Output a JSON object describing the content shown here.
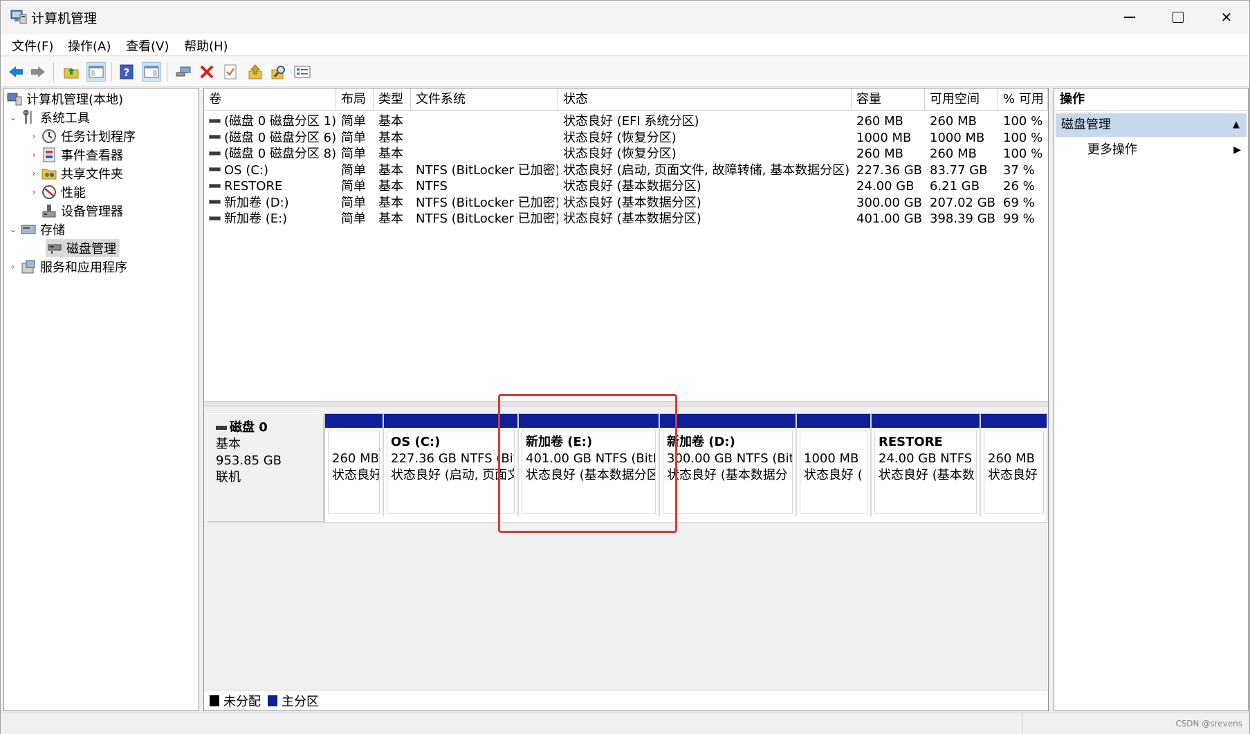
{
  "window": {
    "title": "计算机管理"
  },
  "menu": [
    "文件(F)",
    "操作(A)",
    "查看(V)",
    "帮助(H)"
  ],
  "toolbar": [
    "back-icon",
    "forward-icon",
    "up-folder-icon",
    "show-hide-tree-icon",
    "help-icon",
    "show-hide-action-pane-icon",
    "connect-icon",
    "delete-icon",
    "properties-icon",
    "export-icon",
    "search-icon",
    "view-icon"
  ],
  "tree": {
    "root": "计算机管理(本地)",
    "system_tools": "系统工具",
    "task_scheduler": "任务计划程序",
    "event_viewer": "事件查看器",
    "shared_folders": "共享文件夹",
    "performance": "性能",
    "device_manager": "设备管理器",
    "storage": "存储",
    "disk_management": "磁盘管理",
    "services_apps": "服务和应用程序"
  },
  "table": {
    "columns": [
      "卷",
      "布局",
      "类型",
      "文件系统",
      "状态",
      "容量",
      "可用空间",
      "% 可用"
    ],
    "rows": [
      [
        "(磁盘 0 磁盘分区 1)",
        "简单",
        "基本",
        "",
        "状态良好 (EFI 系统分区)",
        "260 MB",
        "260 MB",
        "100 %"
      ],
      [
        "(磁盘 0 磁盘分区 6)",
        "简单",
        "基本",
        "",
        "状态良好 (恢复分区)",
        "1000 MB",
        "1000 MB",
        "100 %"
      ],
      [
        "(磁盘 0 磁盘分区 8)",
        "简单",
        "基本",
        "",
        "状态良好 (恢复分区)",
        "260 MB",
        "260 MB",
        "100 %"
      ],
      [
        "OS (C:)",
        "简单",
        "基本",
        "NTFS (BitLocker 已加密)",
        "状态良好 (启动, 页面文件, 故障转储, 基本数据分区)",
        "227.36 GB",
        "83.77 GB",
        "37 %"
      ],
      [
        "RESTORE",
        "简单",
        "基本",
        "NTFS",
        "状态良好 (基本数据分区)",
        "24.00 GB",
        "6.21 GB",
        "26 %"
      ],
      [
        "新加卷 (D:)",
        "简单",
        "基本",
        "NTFS (BitLocker 已加密)",
        "状态良好 (基本数据分区)",
        "300.00 GB",
        "207.02 GB",
        "69 %"
      ],
      [
        "新加卷 (E:)",
        "简单",
        "基本",
        "NTFS (BitLocker 已加密)",
        "状态良好 (基本数据分区)",
        "401.00 GB",
        "398.39 GB",
        "99 %"
      ]
    ]
  },
  "disk": {
    "name": "磁盘 0",
    "type": "基本",
    "size": "953.85 GB",
    "status": "联机",
    "partitions": [
      {
        "name": "",
        "line1": "260 MB",
        "line2": "状态良好"
      },
      {
        "name": "OS  (C:)",
        "line1": "227.36 GB NTFS (BitL",
        "line2": "状态良好 (启动, 页面文"
      },
      {
        "name": "新加卷  (E:)",
        "line1": "401.00 GB NTFS (BitLo",
        "line2": "状态良好 (基本数据分区"
      },
      {
        "name": "新加卷  (D:)",
        "line1": "300.00 GB NTFS (BitL",
        "line2": "状态良好 (基本数据分"
      },
      {
        "name": "",
        "line1": "1000 MB",
        "line2": "状态良好 ("
      },
      {
        "name": "RESTORE",
        "line1": "24.00 GB NTFS",
        "line2": "状态良好 (基本数"
      },
      {
        "name": "",
        "line1": "260 MB",
        "line2": "状态良好"
      }
    ]
  },
  "legend": {
    "unallocated": "未分配",
    "primary": "主分区"
  },
  "colors": {
    "primary_partition": "#0f1f97",
    "unallocated": "#000000",
    "highlight": "#d63b3b",
    "action_section": "#c7d9ee"
  },
  "actions": {
    "header": "操作",
    "section": "磁盘管理",
    "more": "更多操作"
  },
  "watermark": "CSDN @srevens"
}
